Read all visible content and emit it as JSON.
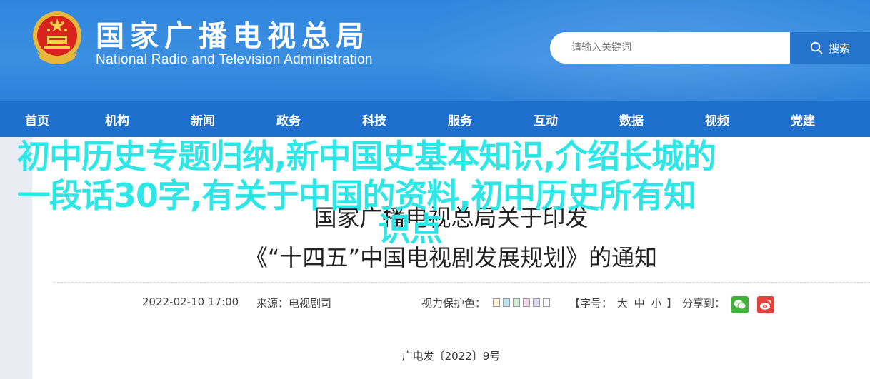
{
  "header": {
    "site_title": "国家广播电视总局",
    "site_subtitle": "National Radio and Television Administration",
    "search_placeholder": "请输入关键词",
    "search_label": "搜索"
  },
  "nav": {
    "items": [
      "首页",
      "机构",
      "新闻",
      "政务",
      "科技",
      "服务",
      "互动",
      "数据",
      "视频",
      "党建"
    ]
  },
  "article": {
    "title_line1": "国家广播电视总局关于印发",
    "title_line2": "《“十四五”中国电视剧发展规划》的通知",
    "date": "2022-02-10 17:00",
    "source": "来源：电视剧司",
    "vision_label": "视力保护色：",
    "font_prefix": "【字号：",
    "font_large": "大",
    "font_medium": "中",
    "font_small": "小",
    "font_suffix": "】",
    "share_label": "分享到：",
    "doc_number": "广电发〔2022〕9号",
    "swatch_colors": [
      "#fbf2d2",
      "#bfe4f3",
      "#cdeed0",
      "#f3dbe7",
      "#e3d9f3",
      "#ffffff"
    ]
  },
  "overlay": {
    "line1": "初中历史专题归纳,新中国史基本知识,介绍长城的",
    "line2": "一段话30字,有关于中国的资料,初中历史所有知",
    "line3": "识点"
  },
  "colors": {
    "header_blue": "#2f86dd",
    "nav_blue": "#1f6fcd",
    "overlay_cyan": "#2ee6e6",
    "wechat_green": "#3fb337",
    "weibo_red": "#e6423c"
  }
}
